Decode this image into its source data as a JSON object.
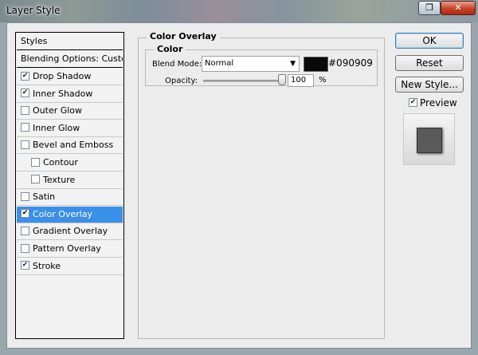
{
  "window": {
    "title": "Layer Style"
  },
  "styles_list": {
    "header": "Styles",
    "blending": "Blending Options: Custom",
    "items": [
      {
        "label": "Drop Shadow",
        "checked": true,
        "indent": false,
        "selected": false
      },
      {
        "label": "Inner Shadow",
        "checked": true,
        "indent": false,
        "selected": false
      },
      {
        "label": "Outer Glow",
        "checked": false,
        "indent": false,
        "selected": false
      },
      {
        "label": "Inner Glow",
        "checked": false,
        "indent": false,
        "selected": false
      },
      {
        "label": "Bevel and Emboss",
        "checked": false,
        "indent": false,
        "selected": false
      },
      {
        "label": "Contour",
        "checked": false,
        "indent": true,
        "selected": false
      },
      {
        "label": "Texture",
        "checked": false,
        "indent": true,
        "selected": false
      },
      {
        "label": "Satin",
        "checked": false,
        "indent": false,
        "selected": false
      },
      {
        "label": "Color Overlay",
        "checked": true,
        "indent": false,
        "selected": true
      },
      {
        "label": "Gradient Overlay",
        "checked": false,
        "indent": false,
        "selected": false
      },
      {
        "label": "Pattern Overlay",
        "checked": false,
        "indent": false,
        "selected": false
      },
      {
        "label": "Stroke",
        "checked": true,
        "indent": false,
        "selected": false
      }
    ]
  },
  "panel": {
    "group_title": "Color Overlay",
    "subgroup_title": "Color",
    "blend_mode_label": "Blend Mode:",
    "blend_mode_value": "Normal",
    "color_hex": "#090909",
    "opacity_label": "Opacity:",
    "opacity_value": "100",
    "opacity_unit": "%"
  },
  "buttons": {
    "ok": "OK",
    "reset": "Reset",
    "new_style": "New Style...",
    "preview_label": "Preview",
    "preview_checked": true
  },
  "colors": {
    "selection": "#3a8fe8",
    "overlay_color": "#090909",
    "preview_square": "#5a5a5a"
  },
  "icons": {
    "restore": "restore-window-icon",
    "close": "close-icon",
    "dropdown": "chevron-down-icon",
    "check": "checkmark-icon"
  }
}
